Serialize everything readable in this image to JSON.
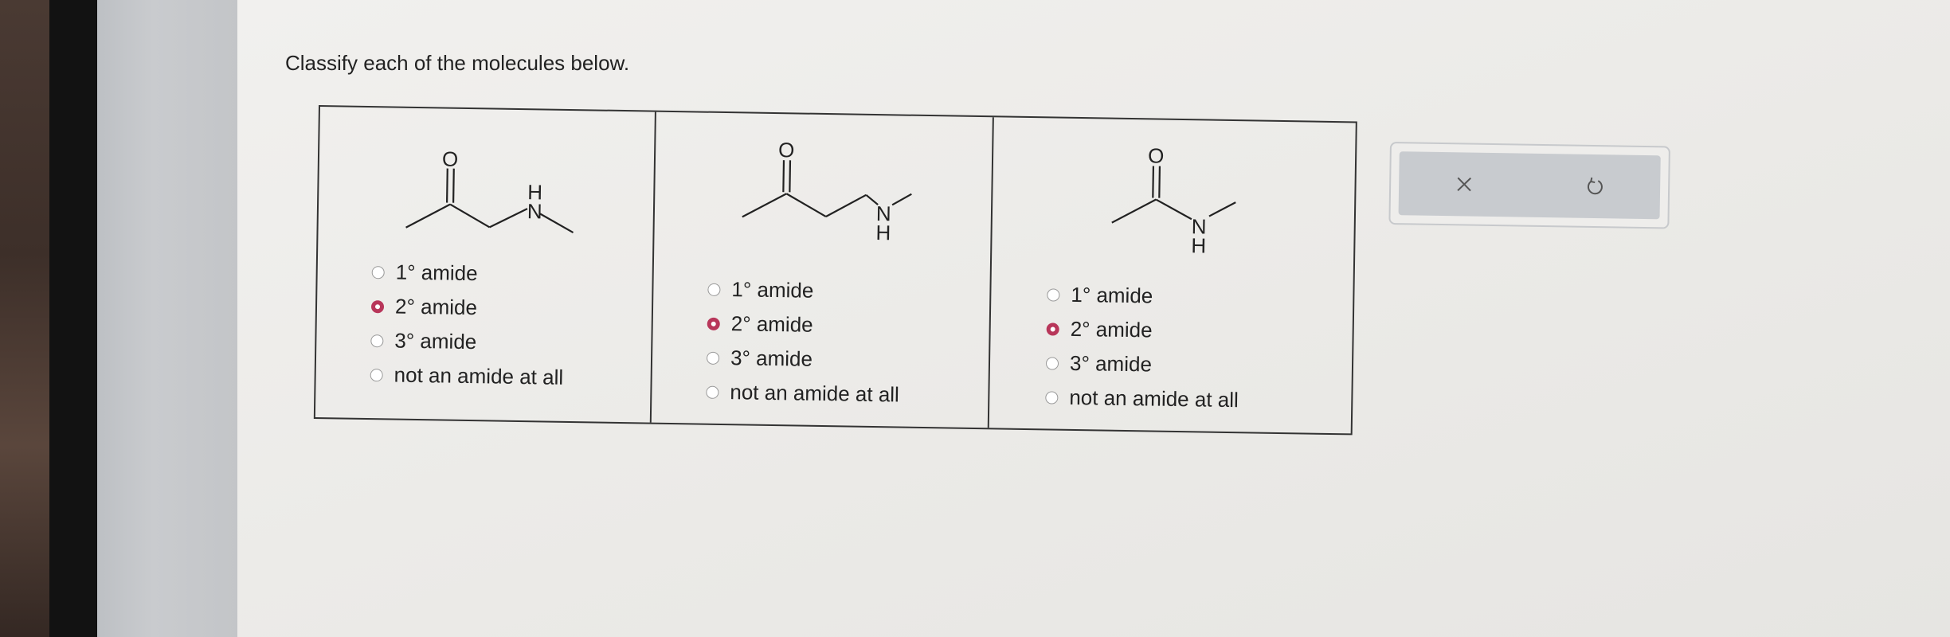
{
  "question": {
    "prompt": "Classify each of the molecules below."
  },
  "molecules": [
    {
      "atoms": {
        "oxygen": "O",
        "nitrogen": "N",
        "hydrogen": "H"
      },
      "options": [
        "1° amide",
        "2° amide",
        "3° amide",
        "not an amide at all"
      ],
      "selected": "2° amide"
    },
    {
      "atoms": {
        "oxygen": "O",
        "nitrogen": "N",
        "hydrogen": "H"
      },
      "options": [
        "1° amide",
        "2° amide",
        "3° amide",
        "not an amide at all"
      ],
      "selected": "2° amide"
    },
    {
      "atoms": {
        "oxygen": "O",
        "nitrogen": "N",
        "hydrogen": "H"
      },
      "options": [
        "1° amide",
        "2° amide",
        "3° amide",
        "not an amide at all"
      ],
      "selected": "2° amide"
    }
  ],
  "actions": {
    "clear_icon": "x-icon",
    "undo_icon": "undo-icon"
  },
  "colors": {
    "selected_radio": "#b8365a",
    "action_bar": "#c8cbcf"
  }
}
